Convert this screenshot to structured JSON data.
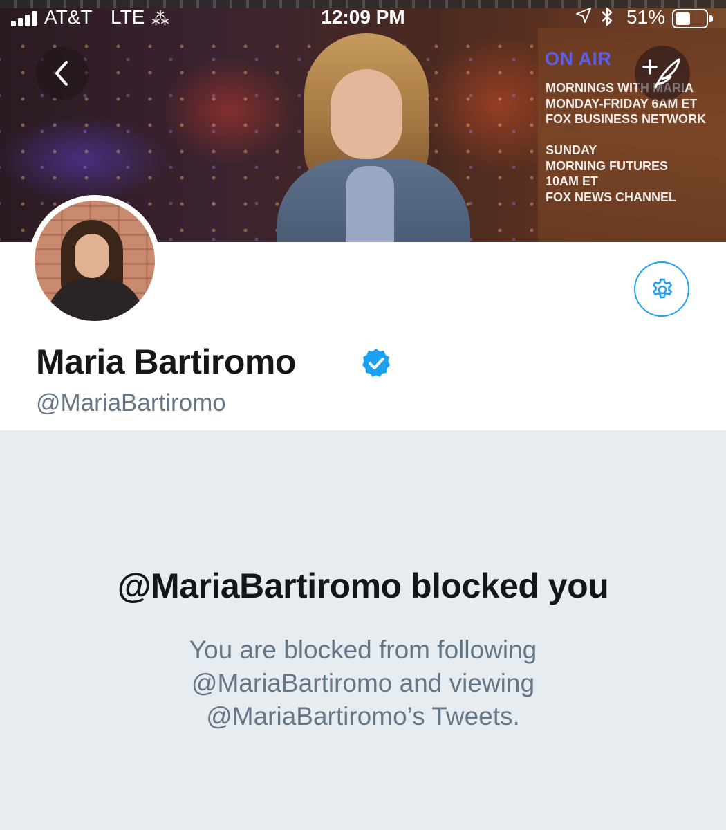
{
  "status_bar": {
    "carrier": "AT&T",
    "network": "LTE",
    "time": "12:09 PM",
    "battery_percent_label": "51%",
    "battery_level": 0.51,
    "icons": [
      "signal-bars-icon",
      "loading-spinner-icon",
      "location-arrow-icon",
      "bluetooth-icon",
      "battery-icon"
    ]
  },
  "banner": {
    "on_air": "ON AIR",
    "show_info": "MORNINGS WITH MARIA\nMONDAY-FRIDAY 6AM ET\nFOX BUSINESS NETWORK\n\nSUNDAY\nMORNING FUTURES\n10AM ET\nFOX NEWS CHANNEL"
  },
  "profile": {
    "name": "Maria Bartiromo",
    "handle": "@MariaBartiromo",
    "verified": true
  },
  "blocked": {
    "title": "@MariaBartiromo blocked you",
    "message": "You are blocked from following @MariaBartiromo and viewing @MariaBartiromo’s Tweets."
  },
  "colors": {
    "accent": "#1da1f2",
    "name_text": "#14171a",
    "secondary_text": "#657786",
    "page_background": "#e6ecf0",
    "on_air": "#5a5ee8"
  }
}
